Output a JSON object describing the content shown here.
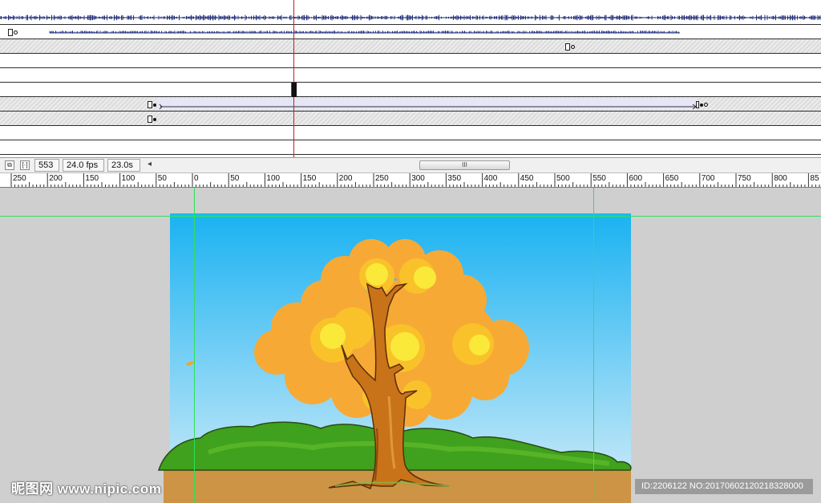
{
  "timeline": {
    "playhead_frame": "553",
    "frame_rate": "24.0 fps",
    "elapsed_time": "23.0s",
    "scroll_left_glyph": "◂",
    "scroll_thumb_glyph": "III"
  },
  "ruler": {
    "labels": [
      "250",
      "200",
      "150",
      "100",
      "50",
      "0",
      "50",
      "100",
      "150",
      "200",
      "250",
      "300",
      "350",
      "400",
      "450",
      "500",
      "550",
      "600",
      "650",
      "700",
      "750",
      "800",
      "85"
    ]
  },
  "watermark": {
    "logo_text": "昵图网 www.nipic.com",
    "id_text": "ID:2206122 NO:20170602120218328000"
  },
  "colors": {
    "sky_top": "#1ab2f2",
    "sky_bottom": "#bfe6f8",
    "foliage": "#f7a935",
    "trunk": "#c8731a",
    "grass": "#3fa11d",
    "ground": "#cc9444",
    "guide": "#2ee05a"
  }
}
